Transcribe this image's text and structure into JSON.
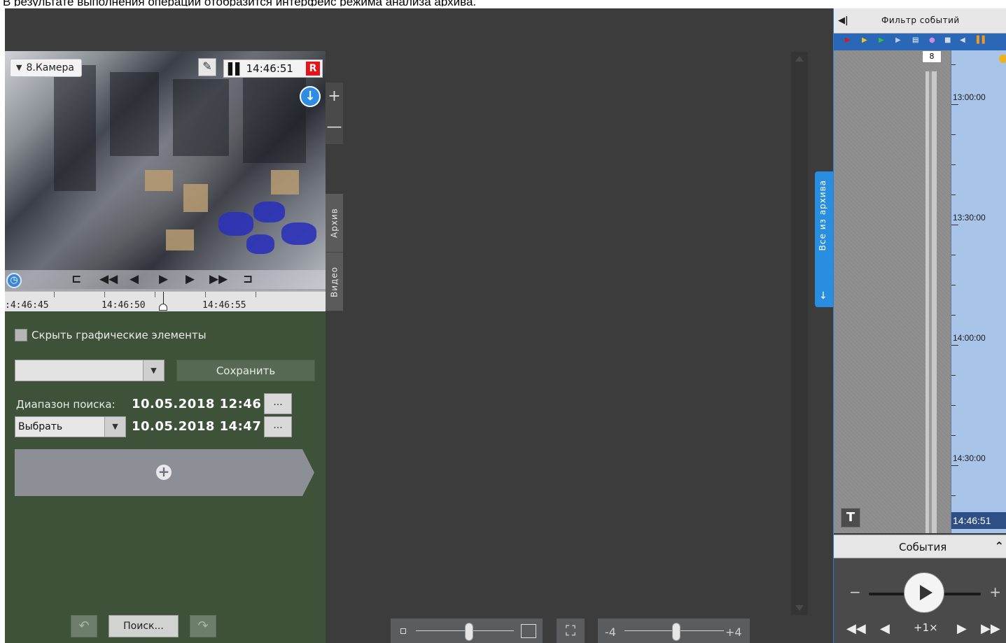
{
  "caption": "В результате выполнения операции отобразится интерфейс режима анализа архива.",
  "camera": {
    "name": "8.Камера",
    "time": "14:46:51",
    "rec_badge": "R",
    "timeline": {
      "labels": [
        ":4:46:45",
        "14:46:50",
        "14:46:55"
      ]
    }
  },
  "zoom": {
    "plus": "+",
    "minus": "—"
  },
  "side_tabs": {
    "archive": "Архив",
    "video": "Видео"
  },
  "search": {
    "hide_graphics_label": "Скрыть графические элементы",
    "preset_value": "",
    "save_label": "Сохранить",
    "range_label": "Диапазон поиска:",
    "from_date": "10.05.2018  12:46",
    "to_date": "10.05.2018  14:47",
    "dots": "...",
    "choose_label": "Выбрать",
    "add_symbol": "+",
    "search_label": "Поиск..."
  },
  "bottom_bar": {
    "min_label": "-4",
    "max_label": "+4"
  },
  "archive_tab": {
    "label": "Все из архива",
    "arrow": "↓"
  },
  "right_panel": {
    "title": "Фильтр событий",
    "badge": "8",
    "times": [
      "13:00:00",
      "13:30:00",
      "14:00:00",
      "14:30:00"
    ],
    "current_time": "14:46:51",
    "t_button": "T",
    "events_title": "События",
    "speed": "+1×"
  },
  "colors": {
    "workspace": "#3c3c3c",
    "search_panel": "#3d5239",
    "accent_blue": "#2a8ee0",
    "rec_red": "#e5141b"
  }
}
